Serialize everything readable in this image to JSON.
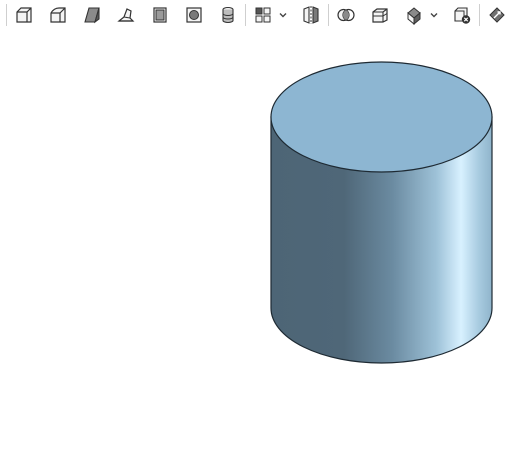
{
  "toolbar": {
    "tools": [
      {
        "icon": "extrude-icon"
      },
      {
        "icon": "revolve-icon"
      },
      {
        "icon": "sweep-icon"
      },
      {
        "icon": "loft-icon"
      },
      {
        "icon": "thicken-icon"
      },
      {
        "icon": "enclose-icon"
      },
      {
        "icon": "cylinder-stack-icon"
      },
      {
        "icon": "pattern-icon",
        "has_dropdown": true
      },
      {
        "icon": "mirror-icon"
      },
      {
        "icon": "boolean-icon"
      },
      {
        "icon": "split-icon"
      },
      {
        "icon": "transform-icon",
        "has_dropdown": true
      },
      {
        "icon": "delete-part-icon"
      },
      {
        "icon": "replace-face-icon"
      }
    ]
  },
  "viewport": {
    "shape": "cylinder",
    "colors": {
      "top_face": "#8db6d2",
      "side_dark": "#4f6778",
      "side_light": "#d7f0ff",
      "edge": "#1e2a33"
    }
  }
}
